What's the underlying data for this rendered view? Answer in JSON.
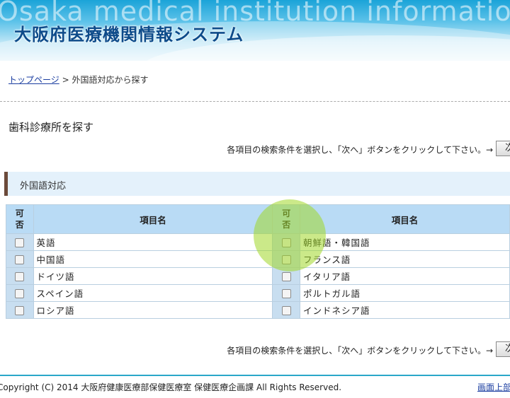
{
  "header": {
    "english_title": "Osaka medical institution information system",
    "title": "大阪府医療機関情報システム"
  },
  "breadcrumb": {
    "home_link": "トップページ",
    "separator": ">",
    "current": "外国語対応から探す"
  },
  "page_heading": "歯科診療所を探す",
  "instruction": "各項目の検索条件を選択し、「次へ」ボタンをクリックして下さい。→",
  "next_button": "次",
  "section": {
    "title": "外国語対応"
  },
  "table": {
    "col_ok_line1": "可",
    "col_ok_line2": "否",
    "col_name": "項目名",
    "rows": [
      {
        "left": "英語",
        "right": "朝鮮語・韓国語"
      },
      {
        "left": "中国語",
        "right": "フランス語"
      },
      {
        "left": "ドイツ語",
        "right": "イタリア語"
      },
      {
        "left": "スペイン語",
        "right": "ポルトガル語"
      },
      {
        "left": "ロシア語",
        "right": "インドネシア語"
      }
    ]
  },
  "footer": {
    "copyright": "Copyright (C) 2014 大阪府健康医療部保健医療室  保健医療企画課 All Rights Reserved.",
    "to_top": "画面上部"
  }
}
